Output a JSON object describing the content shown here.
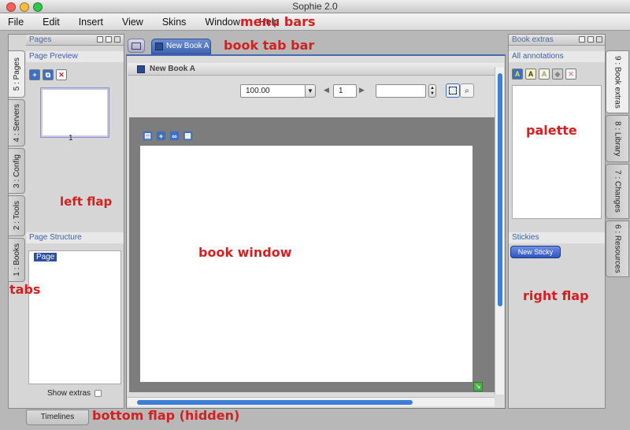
{
  "window": {
    "title": "Sophie 2.0"
  },
  "menu": {
    "items": [
      "File",
      "Edit",
      "Insert",
      "View",
      "Skins",
      "Window",
      "Help"
    ]
  },
  "labels": {
    "menu_bars": "menu bars",
    "book_tab_bar": "book tab bar",
    "left_flap": "left flap",
    "tabs": "tabs",
    "book_window": "book window",
    "palette": "palette",
    "right_flap": "right flap",
    "bottom_flap": "bottom flap (hidden)"
  },
  "left_flap": {
    "panel_title": "Pages",
    "page_preview_title": "Page Preview",
    "page_number": "1",
    "page_structure_title": "Page Structure",
    "structure_item": "Page",
    "show_extras": "Show extras",
    "tabs": [
      "5 : Pages",
      "4 : Servers",
      "3 : Config",
      "2 : Tools",
      "1 : Books"
    ]
  },
  "book_tabs": {
    "active_tab": "New Book A"
  },
  "book_window": {
    "title": "New Book A",
    "zoom_value": "100.00",
    "page_field": "1",
    "size_field": ""
  },
  "right_flap": {
    "panel_title": "Book extras",
    "annotations_title": "All annotations",
    "stickies_title": "Stickies",
    "new_sticky": "New Sticky",
    "tabs": [
      "9 : Book extras",
      "8 : Library",
      "7 : Changes",
      "6 : Resources"
    ]
  },
  "bottom_flap": {
    "tab_label": "Timelines"
  },
  "colors": {
    "annotation_red": "#d42020",
    "scroll_blue": "#3d7fd6",
    "sticky_blue": "#3a63c8"
  }
}
